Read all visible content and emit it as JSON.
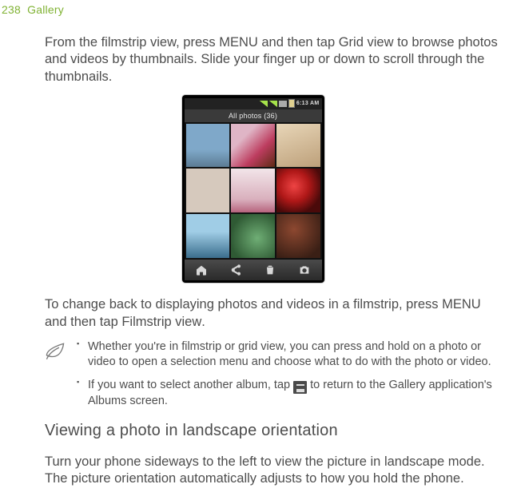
{
  "header": {
    "page_number": "238",
    "section_title": "Gallery"
  },
  "para1_a": "From the filmstrip view, press MENU and then tap ",
  "para1_bold": "Grid view",
  "para1_b": " to browse photos and videos by thumbnails. Slide your finger up or down to scroll through the thumbnails.",
  "phone": {
    "status_time": "6:13 AM",
    "title": "All photos (36)"
  },
  "para2_a": "To change back to displaying photos and videos in a filmstrip, press MENU and then tap ",
  "para2_bold": "Filmstrip view",
  "para2_b": ".",
  "tips": {
    "t1": "Whether you're in filmstrip or grid view, you can press and hold on a photo or video to open a selection menu and choose what to do with the photo or video.",
    "t2_a": "If you want to select another album, tap ",
    "t2_b": " to return to the Gallery application's Albums screen."
  },
  "h2": "Viewing a photo in landscape orientation",
  "para3": "Turn your phone sideways to the left to view the picture in landscape mode. The picture orientation automatically adjusts to how you hold the phone."
}
